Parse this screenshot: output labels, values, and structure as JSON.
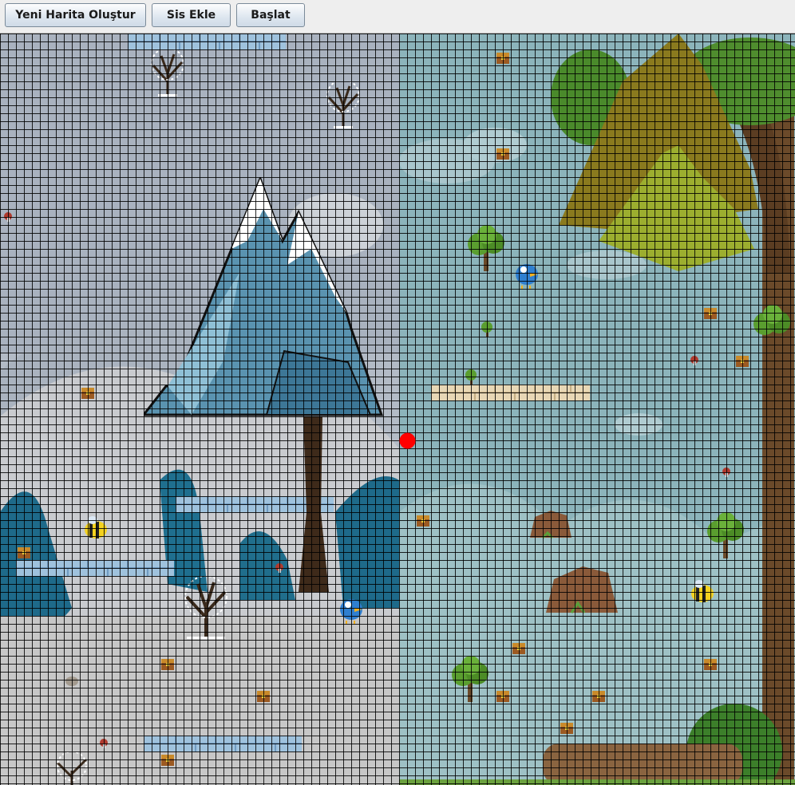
{
  "toolbar": {
    "new_map_label": "Yeni Harita Oluştur",
    "add_fog_label": "Sis Ekle",
    "start_label": "Başlat"
  },
  "map": {
    "left_region": "winter",
    "right_region": "summer",
    "grid_cell": "10x10",
    "player": {
      "icon": "red-dot",
      "color": "#ff0000"
    },
    "colors": {
      "winter_bg": "#b9c1cc",
      "summer_bg": "#8eb6bd",
      "grid": "#000000",
      "player": "#ff0000"
    }
  }
}
